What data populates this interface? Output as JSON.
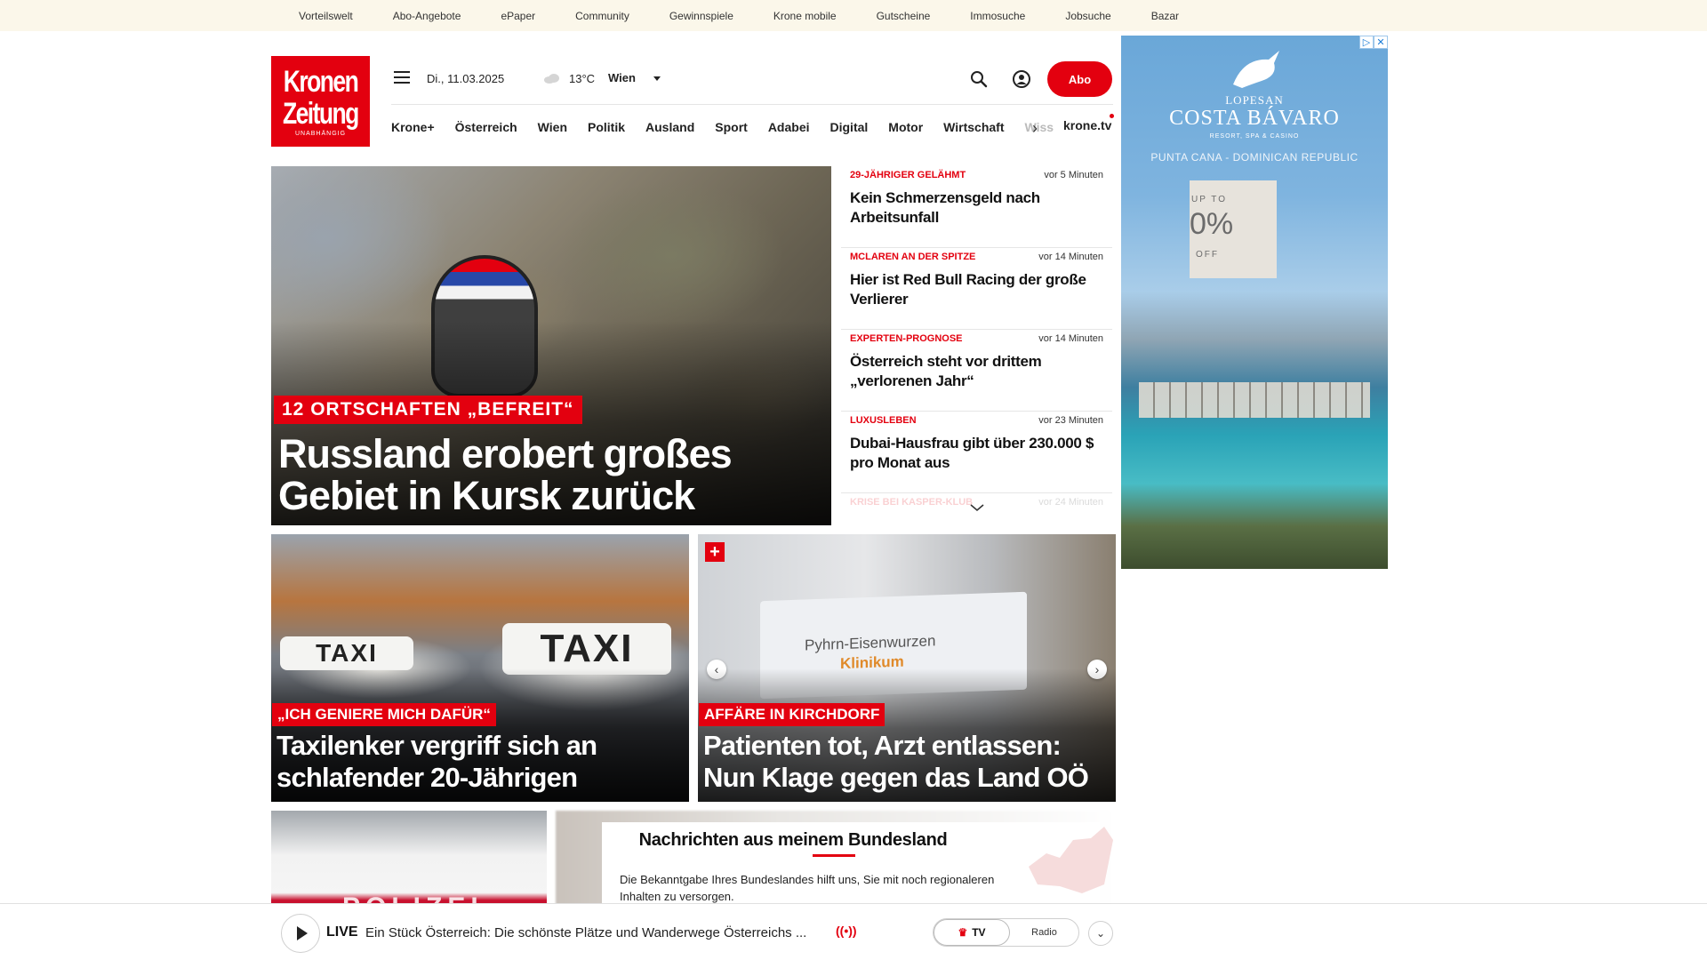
{
  "topbar": {
    "links": [
      "Vorteilswelt",
      "Abo-Angebote",
      "ePaper",
      "Community",
      "Gewinnspiele",
      "Krone mobile",
      "Gutscheine",
      "Immosuche",
      "Jobsuche",
      "Bazar"
    ]
  },
  "logo": {
    "line1": "Kronen",
    "line2": "Zeitung",
    "tagline": "UNABHÄNGIG"
  },
  "header": {
    "date": "Di., 11.03.2025",
    "temperature": "13°C",
    "city": "Wien",
    "abo_label": "Abo",
    "icons": {
      "menu": "hamburger-menu-icon",
      "weather": "cloud-icon",
      "search": "search-icon",
      "account": "user-icon"
    }
  },
  "nav": {
    "items": [
      "Krone+",
      "Österreich",
      "Wien",
      "Politik",
      "Ausland",
      "Sport",
      "Adabei",
      "Digital",
      "Motor",
      "Wirtschaft"
    ],
    "truncated_item": "Wiss",
    "tv_link": "krone.tv"
  },
  "hero": {
    "kicker": "12 ORTSCHAFTEN „BEFREIT“",
    "title": "Russland erobert großes Gebiet in Kursk zurück"
  },
  "news_list": [
    {
      "category": "29-JÄHRIGER GELÄHMT",
      "time": "vor 5 Minuten",
      "headline": "Kein Schmerzensgeld nach Arbeitsunfall"
    },
    {
      "category": "MCLAREN AN DER SPITZE",
      "time": "vor 14 Minuten",
      "headline": "Hier ist Red Bull Racing der große Verlierer"
    },
    {
      "category": "EXPERTEN-PROGNOSE",
      "time": "vor 14 Minuten",
      "headline": "Österreich steht vor drittem „verlorenen Jahr“"
    },
    {
      "category": "LUXUSLEBEN",
      "time": "vor 23 Minuten",
      "headline": "Dubai-Hausfrau gibt über 230.000 $ pro Monat aus"
    },
    {
      "category": "KRISE BEI KASPER-KLUB",
      "time": "vor 24 Minuten",
      "headline": ""
    }
  ],
  "stories": [
    {
      "kicker": "„ICH GENIERE MICH DAFÜR“",
      "title": "Taxilenker vergriff sich an schlafender 20-Jährigen",
      "sign_text": "TAXI"
    },
    {
      "kicker": "AFFÄRE IN KIRCHDORF",
      "title": "Patienten tot, Arzt entlassen: Nun Klage gegen das Land OÖ",
      "sign_line1": "Pyhrn-Eisenwurzen",
      "sign_line2": "Klinikum"
    }
  ],
  "police_image": {
    "word": "POLIZEI"
  },
  "bundesland": {
    "title": "Nachrichten aus meinem Bundesland",
    "body": "Die Bekanntgabe Ihres Bundeslandes hilft uns, Sie mit noch regionaleren Inhalten zu versorgen."
  },
  "ad": {
    "brand_line1": "LOPESAN",
    "brand_line2": "COSTA BÁVARO",
    "brand_line3": "RESORT, SPA & CASINO",
    "location": "PUNTA CANA - DOMINICAN REPUBLIC",
    "offer_up_to": "UP TO",
    "offer_value": "0%",
    "offer_off": "OFF"
  },
  "livebar": {
    "live_label": "LIVE",
    "text": "Ein Stück Österreich: Die schönste Plätze und Wanderwege Österreichs ...",
    "tv_label": "TV",
    "radio_label": "Radio"
  },
  "colors": {
    "brand_red": "#e3000f",
    "topbar_bg": "#fbf7ea"
  }
}
